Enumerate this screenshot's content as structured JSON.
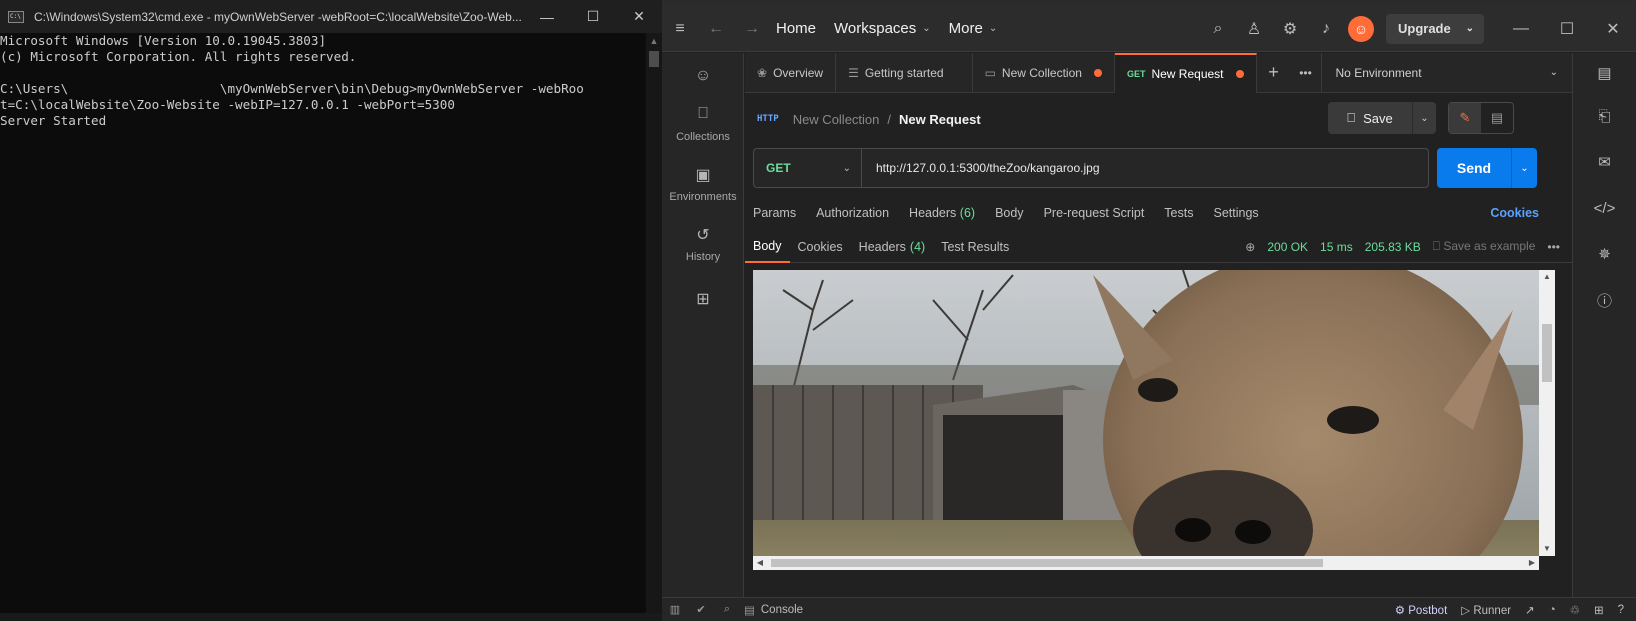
{
  "cmd": {
    "title": "C:\\Windows\\System32\\cmd.exe - myOwnWebServer  -webRoot=C:\\localWebsite\\Zoo-Web...",
    "lines": [
      "Microsoft Windows [Version 10.0.19045.3803]",
      "(c) Microsoft Corporation. All rights reserved.",
      "",
      "C:\\Users\\                    \\myOwnWebServer\\bin\\Debug>myOwnWebServer -webRoo",
      "t=C:\\localWebsite\\Zoo-Website -webIP=127.0.0.1 -webPort=5300",
      "Server Started"
    ]
  },
  "postman": {
    "header": {
      "home": "Home",
      "workspaces": "Workspaces",
      "more": "More",
      "upgrade": "Upgrade"
    },
    "sidebar": [
      {
        "label": "",
        "icon": "user-icon"
      },
      {
        "label": "Collections",
        "icon": "trash-icon"
      },
      {
        "label": "Environments",
        "icon": "env-icon"
      },
      {
        "label": "History",
        "icon": "history-icon"
      },
      {
        "label": "",
        "icon": "apps-icon"
      }
    ],
    "tabs": [
      {
        "label": "Overview",
        "icon": "overview-icon",
        "dot": false
      },
      {
        "label": "Getting started",
        "icon": "doc-icon",
        "dot": false
      },
      {
        "label": "New Collection",
        "icon": "collection-icon",
        "dot": true
      },
      {
        "label": "New Request",
        "method": "GET",
        "dot": true,
        "active": true
      }
    ],
    "environment": "No Environment",
    "breadcrumb": {
      "parent": "New Collection",
      "separator": "/",
      "current": "New Request"
    },
    "save": "Save",
    "request": {
      "method": "GET",
      "url": "http://127.0.0.1:5300/theZoo/kangaroo.jpg",
      "send": "Send"
    },
    "request_tabs": {
      "params": "Params",
      "authorization": "Authorization",
      "headers": "Headers",
      "headers_count": "(6)",
      "body": "Body",
      "prerequest": "Pre-request Script",
      "tests": "Tests",
      "settings": "Settings",
      "cookies": "Cookies"
    },
    "response": {
      "tabs": {
        "body": "Body",
        "cookies": "Cookies",
        "headers": "Headers",
        "headers_count": "(4)",
        "tests": "Test Results"
      },
      "status": "200 OK",
      "time": "15 ms",
      "size": "205.83 KB",
      "save_example": "Save as example"
    },
    "footer": {
      "console": "Console",
      "postbot": "Postbot",
      "runner": "Runner"
    },
    "colors": {
      "accent": "#ff6c37",
      "send": "#097bed",
      "ok": "#6bdd9a",
      "link": "#5aa2ff"
    }
  }
}
